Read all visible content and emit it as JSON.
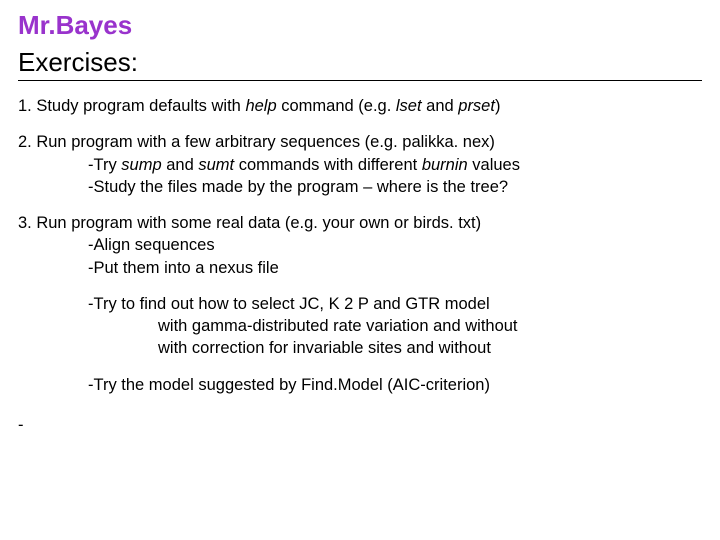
{
  "title": "Mr.Bayes",
  "subtitle": "Exercises:",
  "ex1": {
    "lead": "1. Study program defaults with ",
    "help": "help",
    "mid": " command (e.g. ",
    "lset": "lset",
    "and": " and ",
    "prset": "prset",
    "tail": ")"
  },
  "ex2": {
    "line1": "2. Run program with a few arbitrary sequences (e.g. palikka. nex)",
    "l2a": "-Try ",
    "sump": "sump",
    "l2b": " and ",
    "sumt": "sumt",
    "l2c": " commands with different ",
    "burnin": "burnin",
    "l2d": " values",
    "line3": "-Study the files made by the program – where is the tree?"
  },
  "ex3": {
    "line1": "3. Run program with some real data (e.g. your own or birds. txt)",
    "line2": "-Align sequences",
    "line3": "-Put them into a nexus file",
    "line4": "-Try to find out how to select JC, K 2 P and GTR model",
    "line5": "with gamma-distributed rate variation and without",
    "line6": "with correction for invariable sites and without",
    "line7": "-Try the model suggested by Find.Model (AIC-criterion)"
  },
  "dash": "-"
}
